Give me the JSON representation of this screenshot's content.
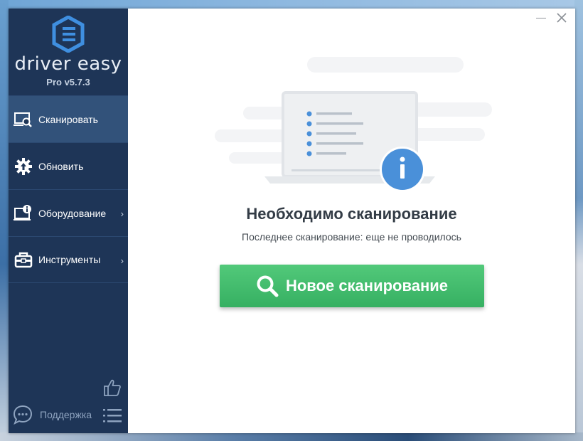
{
  "app": {
    "logo_text": "driver easy",
    "version": "Pro v5.7.3"
  },
  "sidebar": {
    "items": [
      {
        "label": "Сканировать",
        "icon": "scan-icon",
        "active": true,
        "has_submenu": false
      },
      {
        "label": "Обновить",
        "icon": "update-gear-icon",
        "active": false,
        "has_submenu": false
      },
      {
        "label": "Оборудование",
        "icon": "hardware-icon",
        "active": false,
        "has_submenu": true
      },
      {
        "label": "Инструменты",
        "icon": "tools-icon",
        "active": false,
        "has_submenu": true
      }
    ],
    "support_label": "Поддержка",
    "chevron": "›"
  },
  "window_controls": {
    "minimize": "—",
    "close": "×"
  },
  "main": {
    "headline": "Необходимо сканирование",
    "subline": "Последнее сканирование: еще не проводилось",
    "scan_button_label": "Новое сканирование"
  },
  "colors": {
    "sidebar_bg": "#1e3557",
    "sidebar_active": "#32527a",
    "accent_green": "#3dbb6a",
    "info_blue": "#4a90d9"
  }
}
